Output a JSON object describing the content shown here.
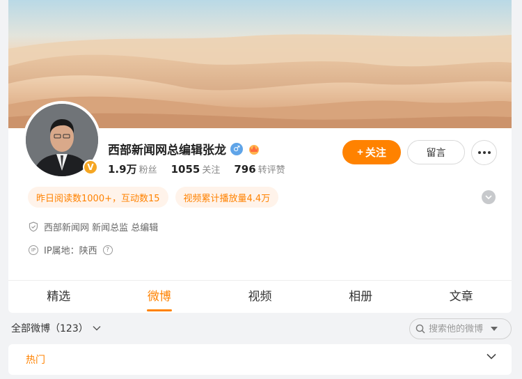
{
  "profile": {
    "name": "西部新闻网总编辑张龙",
    "gender_symbol": "♂",
    "verified_badge": "V",
    "stats": [
      {
        "value": "1.9万",
        "label": "粉丝"
      },
      {
        "value": "1055",
        "label": "关注"
      },
      {
        "value": "796",
        "label": "转评赞"
      }
    ]
  },
  "actions": {
    "follow_label": "关注",
    "follow_plus": "+",
    "message_label": "留言"
  },
  "tags": [
    "昨日阅读数1000+，互动数15",
    "视频累计播放量4.4万"
  ],
  "info": {
    "title": "西部新闻网 新闻总监 总编辑",
    "ip_badge": "IP",
    "ip_location": "IP属地：陕西",
    "help_symbol": "?"
  },
  "tabs": [
    {
      "label": "精选",
      "active": false
    },
    {
      "label": "微博",
      "active": true
    },
    {
      "label": "视频",
      "active": false
    },
    {
      "label": "相册",
      "active": false
    },
    {
      "label": "文章",
      "active": false
    }
  ],
  "feed": {
    "filter_label": "全部微博（123）",
    "search_placeholder": "搜索他的微博",
    "hot_label": "热门"
  },
  "colors": {
    "accent": "#ff8200",
    "tag_bg": "#fff3ea",
    "gender": "#5fa4e8",
    "badge": "#f5a623"
  }
}
